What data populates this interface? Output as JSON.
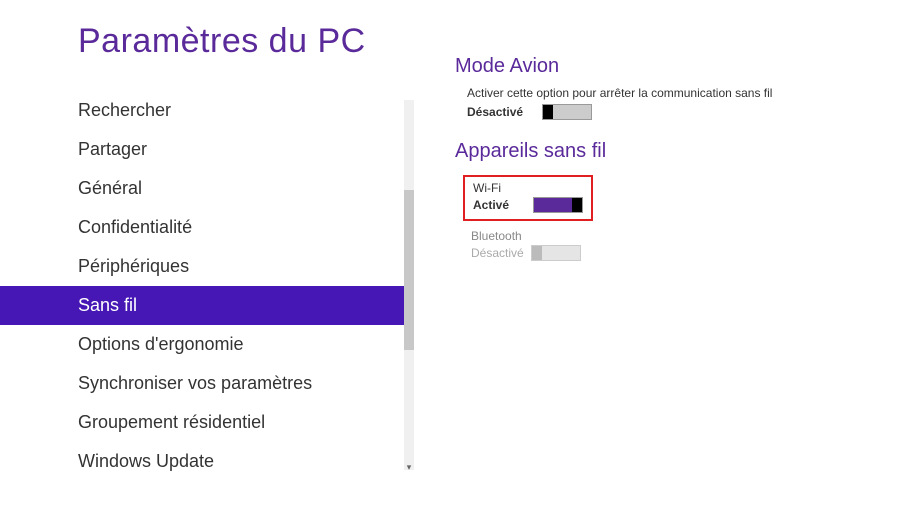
{
  "page_title": "Paramètres du PC",
  "sidebar": {
    "items": [
      {
        "label": "Rechercher",
        "selected": false
      },
      {
        "label": "Partager",
        "selected": false
      },
      {
        "label": "Général",
        "selected": false
      },
      {
        "label": "Confidentialité",
        "selected": false
      },
      {
        "label": "Périphériques",
        "selected": false
      },
      {
        "label": "Sans fil",
        "selected": true
      },
      {
        "label": "Options d'ergonomie",
        "selected": false
      },
      {
        "label": "Synchroniser vos paramètres",
        "selected": false
      },
      {
        "label": "Groupement résidentiel",
        "selected": false
      },
      {
        "label": "Windows Update",
        "selected": false
      }
    ]
  },
  "content": {
    "airplane": {
      "title": "Mode Avion",
      "description": "Activer cette option pour arrêter la communication sans fil",
      "status": "Désactivé",
      "toggle_state": "off"
    },
    "wireless": {
      "title": "Appareils sans fil",
      "wifi": {
        "label": "Wi-Fi",
        "status": "Activé",
        "toggle_state": "on",
        "highlighted": true
      },
      "bluetooth": {
        "label": "Bluetooth",
        "status": "Désactivé",
        "toggle_state": "disabled"
      }
    }
  },
  "colors": {
    "accent": "#4617b4",
    "heading": "#5a2a9a",
    "highlight_border": "#e02020"
  }
}
